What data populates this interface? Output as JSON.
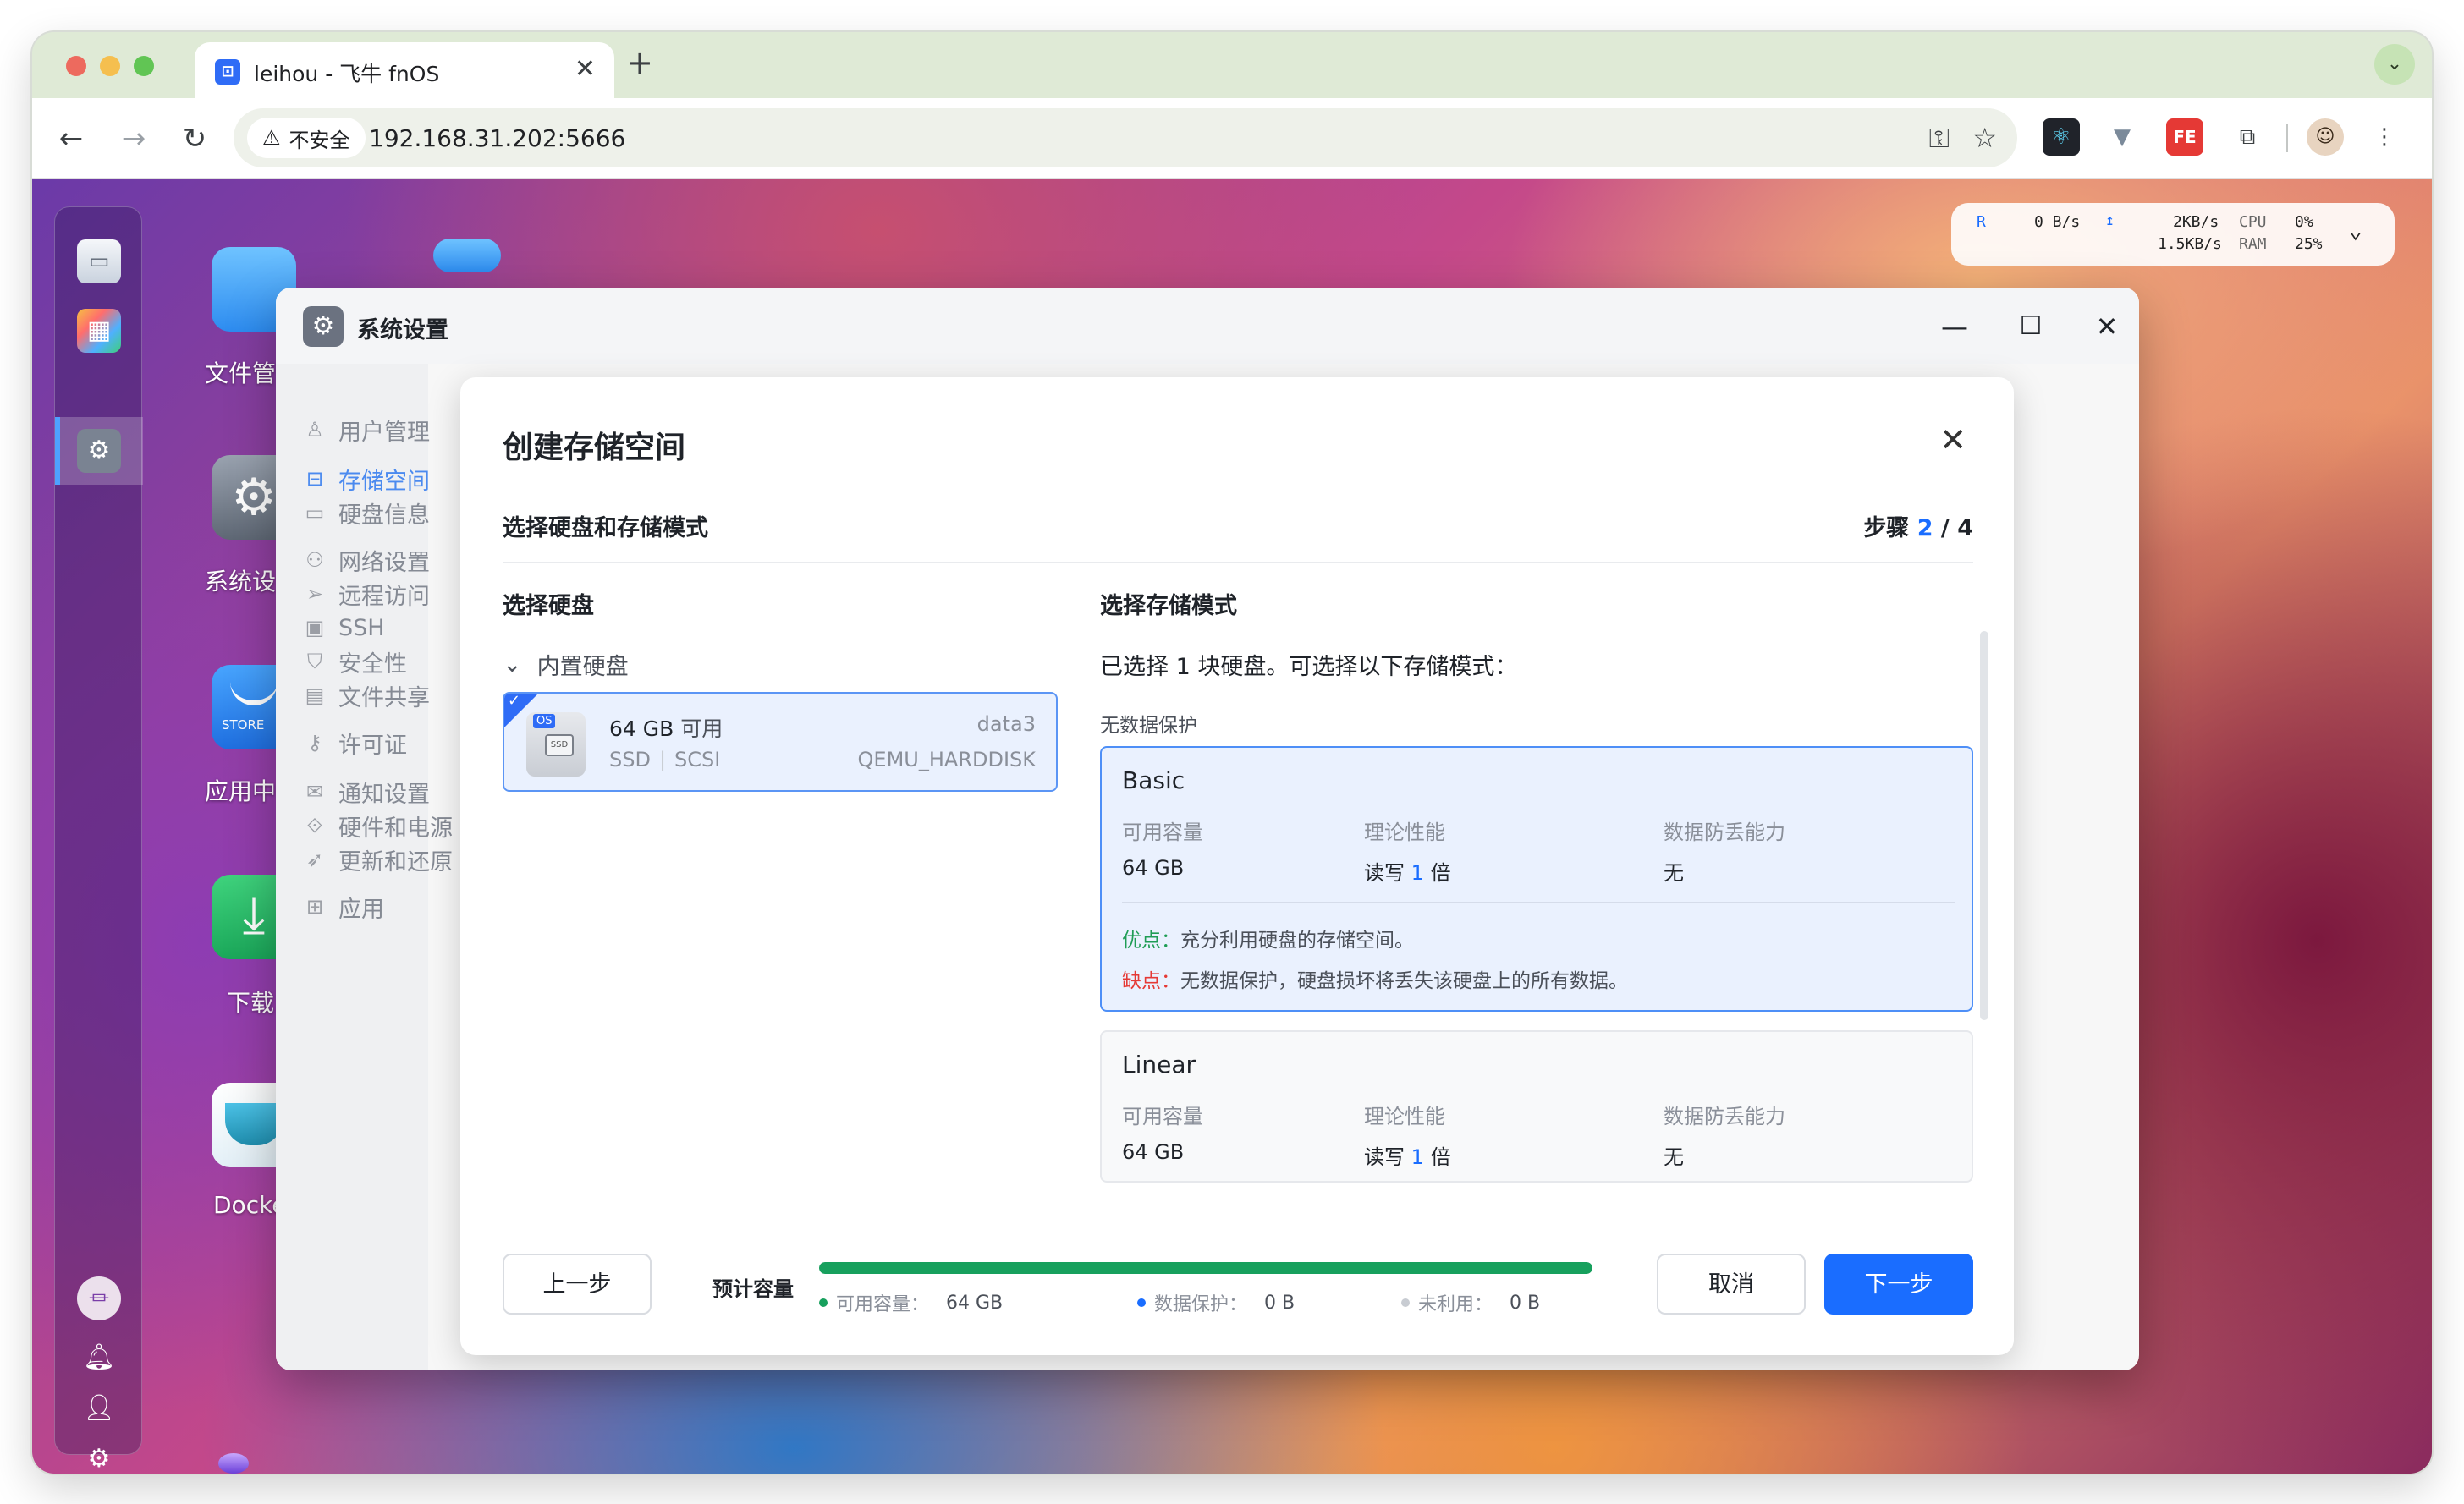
{
  "browser": {
    "tab_title": "leihou - 飞牛 fnOS",
    "tab_close": "✕",
    "new_tab": "+",
    "tab_menu": "⌄",
    "security_label": "不安全",
    "url": "192.168.31.202:5666",
    "icons": [
      "back-icon",
      "forward-icon",
      "reload-icon",
      "warning-icon",
      "key-icon",
      "star-icon",
      "react-extension-icon",
      "vue-extension-icon",
      "fe-extension-icon",
      "puzzle-icon",
      "avatar",
      "more-icon"
    ]
  },
  "netmon": {
    "r_label": "R",
    "speed1": "0 B/s",
    "arrow": "↥",
    "speed2": "2KB/s",
    "speed3": "1.5KB/s",
    "cpu_label": "CPU",
    "ram_label": "RAM",
    "cpu_value": "0%",
    "ram_value": "25%",
    "expand": "⌄"
  },
  "desktop": {
    "apps": [
      {
        "label": "文件管"
      },
      {
        "label": "系统设"
      },
      {
        "label": "应用中"
      },
      {
        "label": "下载"
      },
      {
        "label": "Docke"
      }
    ],
    "store_text": "STORE"
  },
  "system_window": {
    "title": "系统设置",
    "minimize": "—",
    "maximize": "☐",
    "close": "✕",
    "sidebar": [
      {
        "label": "用户管理",
        "icon": "user-icon"
      },
      {
        "label": "存储空间",
        "icon": "storage-icon",
        "active": true
      },
      {
        "label": "硬盘信息",
        "icon": "disk-icon"
      },
      {
        "label": "网络设置",
        "icon": "network-icon"
      },
      {
        "label": "远程访问",
        "icon": "remote-icon"
      },
      {
        "label": "SSH",
        "icon": "ssh-icon"
      },
      {
        "label": "安全性",
        "icon": "shield-icon"
      },
      {
        "label": "文件共享",
        "icon": "file-share-icon"
      },
      {
        "label": "许可证",
        "icon": "key-icon"
      },
      {
        "label": "通知设置",
        "icon": "mail-icon"
      },
      {
        "label": "硬件和电源",
        "icon": "hardware-icon"
      },
      {
        "label": "更新和还原",
        "icon": "rocket-icon"
      },
      {
        "label": "应用",
        "icon": "apps-icon"
      }
    ]
  },
  "modal": {
    "title": "创建存储空间",
    "close": "✕",
    "subtitle": "选择硬盘和存储模式",
    "step_label": "步骤",
    "step_current": "2",
    "step_sep": "/",
    "step_total": "4",
    "disk_section_title": "选择硬盘",
    "disk_group": "内置硬盘",
    "disk": {
      "capacity": "64 GB",
      "available": "可用",
      "name": "data3",
      "type": "SSD",
      "interface": "SCSI",
      "model": "QEMU_HARDDISK",
      "os_badge": "OS",
      "ssd_badge": "SSD"
    },
    "mode_section_title": "选择存储模式",
    "mode_desc": "已选择 1 块硬盘。可选择以下存储模式：",
    "mode_group": "无数据保护",
    "modes": [
      {
        "name": "Basic",
        "cap_label": "可用容量",
        "perf_label": "理论性能",
        "prot_label": "数据防丢能力",
        "cap_value": "64 GB",
        "perf_prefix": "读写",
        "perf_mult": "1",
        "perf_suffix": "倍",
        "prot_value": "无",
        "pro_key": "优点：",
        "pro_text": "充分利用硬盘的存储空间。",
        "con_key": "缺点：",
        "con_text": "无数据保护，硬盘损坏将丢失该硬盘上的所有数据。"
      },
      {
        "name": "Linear",
        "cap_label": "可用容量",
        "perf_label": "理论性能",
        "prot_label": "数据防丢能力",
        "cap_value": "64 GB",
        "perf_prefix": "读写",
        "perf_mult": "1",
        "perf_suffix": "倍",
        "prot_value": "无"
      }
    ],
    "footer": {
      "prev": "上一步",
      "estimate_label": "预计容量",
      "usable_label": "可用容量：",
      "usable_value": "64 GB",
      "protect_label": "数据保护：",
      "protect_value": "0 B",
      "unused_label": "未利用：",
      "unused_value": "0 B",
      "usable_fraction": 1.0,
      "cancel": "取消",
      "next": "下一步"
    }
  },
  "colors": {
    "accent": "#1a6dff",
    "usable": "#17a05d",
    "protect": "#1a6dff",
    "unused": "#c8ccd2",
    "pro": "#1f9d55",
    "con": "#e53935"
  }
}
